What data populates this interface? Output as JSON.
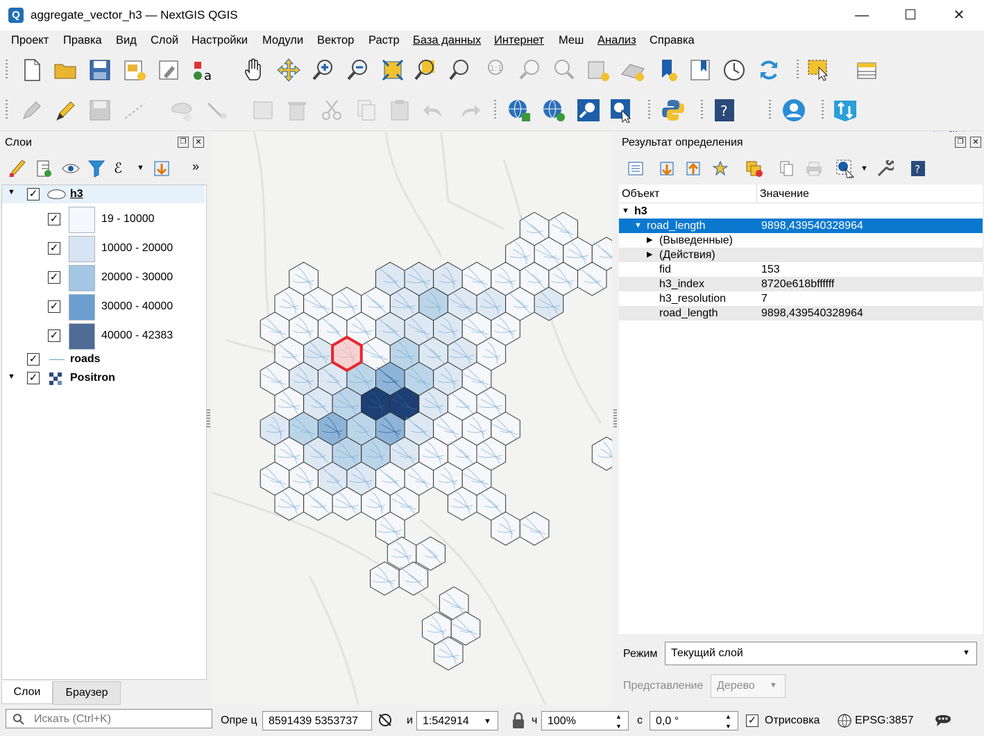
{
  "window": {
    "title": "aggregate_vector_h3 — NextGIS QGIS",
    "app_icon_letter": "Q",
    "minimize": "—",
    "maximize": "☐",
    "close": "✕"
  },
  "menu": [
    "Проект",
    "Правка",
    "Вид",
    "Слой",
    "Настройки",
    "Модули",
    "Вектор",
    "Растр",
    "База данных",
    "Интернет",
    "Меш",
    "Анализ",
    "Справка"
  ],
  "layers_panel": {
    "title": "Слои",
    "layers": {
      "h3": {
        "name": "h3",
        "checked": true
      },
      "legend": [
        {
          "label": "19 - 10000",
          "color": "#f4f7fb"
        },
        {
          "label": "10000 - 20000",
          "color": "#d6e4f3"
        },
        {
          "label": "20000 - 30000",
          "color": "#a3c7e4"
        },
        {
          "label": "30000 - 40000",
          "color": "#6b9fcf"
        },
        {
          "label": "40000 - 42383",
          "color": "#506b96"
        }
      ],
      "roads": {
        "name": "roads",
        "checked": true
      },
      "positron": {
        "name": "Positron",
        "checked": true
      }
    },
    "tabs": {
      "layers": "Слои",
      "browser": "Браузер"
    }
  },
  "identify_panel": {
    "title": "Результат определения",
    "header": {
      "object": "Объект",
      "value": "Значение"
    },
    "root": "h3",
    "rows": [
      {
        "name": "road_length",
        "value": "9898,439540328964"
      },
      {
        "name": "(Выведенные)",
        "value": ""
      },
      {
        "name": "(Действия)",
        "value": ""
      },
      {
        "name": "fid",
        "value": "153"
      },
      {
        "name": "h3_index",
        "value": "8720e618bffffff"
      },
      {
        "name": "h3_resolution",
        "value": "7"
      },
      {
        "name": "road_length",
        "value": "9898,439540328964"
      }
    ],
    "mode_label": "Режим",
    "mode_value": "Текущий слой",
    "view_label": "Представление",
    "view_value": "Дерево"
  },
  "statusbar": {
    "search_placeholder": "Искать (Ctrl+K)",
    "coord_label": "Опре ц",
    "coordinates": "8591439  5353737",
    "scale_label": "и",
    "scale": "1:542914",
    "magnifier_label": "ч",
    "magnifier": "100%",
    "rotation_label": "с",
    "rotation": "0,0 °",
    "render_label": "Отрисовка",
    "crs": "EPSG:3857"
  },
  "map": {
    "selected_hex_color": "#e8262b",
    "hex_stroke": "#333333",
    "road_color": "#7aaed6"
  }
}
